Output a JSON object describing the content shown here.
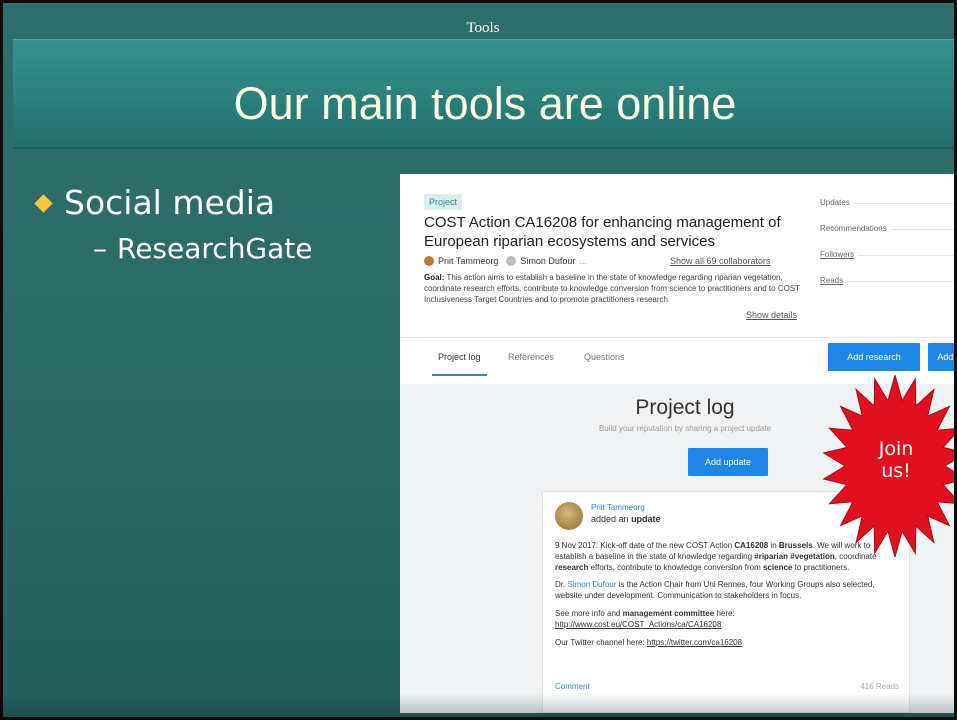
{
  "slide": {
    "section_label": "Tools",
    "title": "Our main tools are online",
    "bullets": [
      {
        "label": "Social media",
        "sub": "ResearchGate"
      }
    ]
  },
  "researchgate": {
    "tag": "Project",
    "title": "COST Action CA16208 for enhancing management of European riparian ecosystems and services",
    "people": [
      "Priit Tammeorg",
      "Simon Dufour",
      "..."
    ],
    "collaborators_link": "Show all 69 collaborators",
    "goal_label": "Goal:",
    "goal_text": "This action aims to establish a baseline in the state of knowledge regarding riparian vegetation, coordinate research efforts, contribute to knowledge conversion from science to practitioners and to COST Inclusiveness Target Countries and to promote practitioners research",
    "details_link": "Show details",
    "stats": [
      "Updates",
      "Recommendations",
      "Followers",
      "Reads"
    ],
    "tabs": [
      "Project log",
      "References",
      "Questions"
    ],
    "add_research": "Add research",
    "add_more": "Add r",
    "log_title": "Project log",
    "log_subtitle": "Build your reputation by sharing a project update",
    "add_update": "Add update",
    "post": {
      "author": "Priit Tammeorg",
      "action_pre": "added an",
      "action_bold": "update",
      "p1_a": "9 Nov 2017: Kick-off date of the new COST Action",
      "p1_b": "CA16208",
      "p1_c": "in",
      "p1_d": "Brussels",
      "p1_e": ". We will work to establish a baseline in the state of knowledge regarding",
      "p1_f": "#riparian #vegetation",
      "p1_g": ", coordinate",
      "p1_h": "research",
      "p1_i": "efforts, contribute to knowledge conversion from",
      "p1_j": "science",
      "p1_k": "to practitioners.",
      "p2_a": "Dr.",
      "p2_b": "Simon Dufour",
      "p2_c": "is the Action Chair from Uni Rennes, four Working Groups also selected, website under development. Communication to stakeholders in focus.",
      "p3_a": "See more info and",
      "p3_b": "management committee",
      "p3_c": "here:",
      "p3_d": "http://www.cost.eu/COST_Actions/ca/CA16208",
      "p4_a": "Our Twitter channel here:",
      "p4_b": "https://twitter.com/ca16208",
      "comment": "Comment",
      "reads": "416 Reads"
    }
  },
  "callout": {
    "text_1": "Join",
    "text_2": "us!"
  },
  "colors": {
    "background": "#2c6a66",
    "title_text": "#fdfde6",
    "bullet_diamond": "#f5c442",
    "starburst": "#e01020",
    "rg_blue": "#1f86e6"
  }
}
